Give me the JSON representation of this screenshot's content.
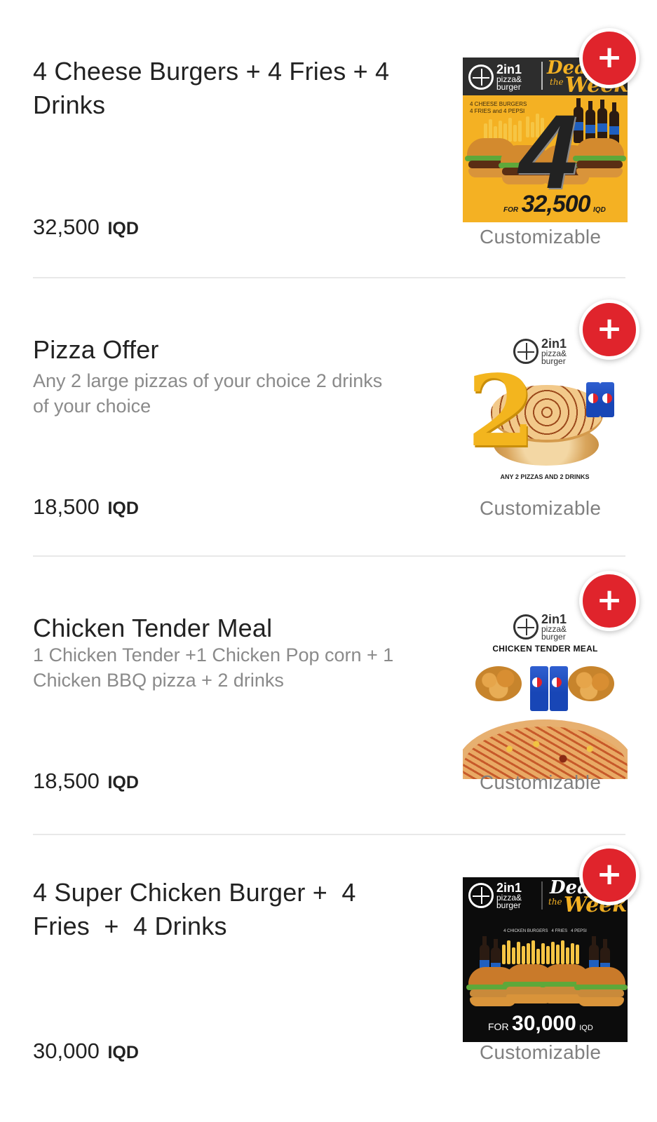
{
  "items": [
    {
      "title": "4 Cheese Burgers + 4 Fries + 4 Drinks",
      "description": "",
      "price": "32,500",
      "currency": "IQD",
      "tag": "Customizable",
      "image": {
        "brand_top": "2in1",
        "brand_sub1": "pizza&",
        "brand_sub2": "burger",
        "deal_word": "Deal",
        "deal_the": "the",
        "deal_week": "Week",
        "caption_line1": "4 CHEESE BURGERS",
        "caption_line2": "4 FRIES and 4 PEPSI",
        "big_number": "4",
        "for_label": "FOR",
        "price_label": "32,500",
        "currency_label": "IQD"
      }
    },
    {
      "title": "Pizza Offer",
      "description": "Any 2 large pizzas of your choice 2 drinks of your choice",
      "price": "18,500",
      "currency": "IQD",
      "tag": "Customizable",
      "image": {
        "brand_top": "2in1",
        "brand_sub1": "pizza&",
        "brand_sub2": "burger",
        "big_number": "2",
        "caption": "ANY 2 PIZZAS AND 2 DRINKS"
      }
    },
    {
      "title": "Chicken Tender Meal",
      "description": "1 Chicken Tender +1 Chicken Pop corn + 1 Chicken BBQ pizza + 2 drinks",
      "price": "18,500",
      "currency": "IQD",
      "tag": "Customizable",
      "image": {
        "brand_top": "2in1",
        "brand_sub1": "pizza&",
        "brand_sub2": "burger",
        "heading": "CHICKEN TENDER MEAL"
      }
    },
    {
      "title": "4 Super Chicken Burger +  4 Fries  +  4 Drinks",
      "description": "",
      "price": "30,000",
      "currency": "IQD",
      "tag": "Customizable",
      "image": {
        "brand_top": "2in1",
        "brand_sub1": "pizza&",
        "brand_sub2": "burger",
        "deal_word": "Deal",
        "deal_the": "the",
        "deal_week": "Week",
        "caption": "4 CHICKEN BURGERS   4 FRIES   4 PEPSI",
        "for_label": "FOR",
        "price_label": "30,000",
        "currency_label": "IQD"
      }
    }
  ],
  "add_button": {
    "icon": "plus-icon",
    "symbol": "+"
  },
  "colors": {
    "accent": "#e0242c",
    "title": "#222222",
    "description": "#8a8a8a",
    "tag": "#808080",
    "divider": "#e8e8e8"
  }
}
